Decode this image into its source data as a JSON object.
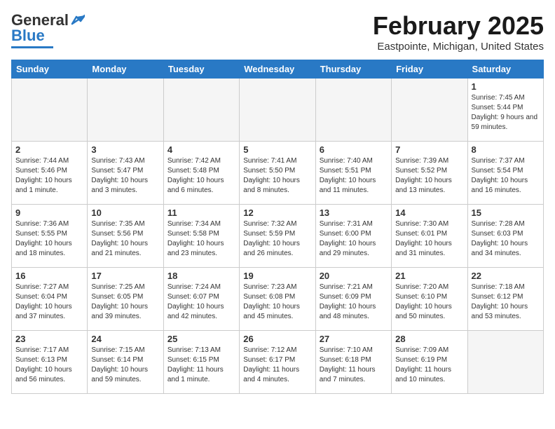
{
  "header": {
    "logo_general": "General",
    "logo_blue": "Blue",
    "title": "February 2025",
    "subtitle": "Eastpointe, Michigan, United States"
  },
  "weekdays": [
    "Sunday",
    "Monday",
    "Tuesday",
    "Wednesday",
    "Thursday",
    "Friday",
    "Saturday"
  ],
  "weeks": [
    [
      {
        "day": "",
        "info": ""
      },
      {
        "day": "",
        "info": ""
      },
      {
        "day": "",
        "info": ""
      },
      {
        "day": "",
        "info": ""
      },
      {
        "day": "",
        "info": ""
      },
      {
        "day": "",
        "info": ""
      },
      {
        "day": "1",
        "info": "Sunrise: 7:45 AM\nSunset: 5:44 PM\nDaylight: 9 hours and 59 minutes."
      }
    ],
    [
      {
        "day": "2",
        "info": "Sunrise: 7:44 AM\nSunset: 5:46 PM\nDaylight: 10 hours and 1 minute."
      },
      {
        "day": "3",
        "info": "Sunrise: 7:43 AM\nSunset: 5:47 PM\nDaylight: 10 hours and 3 minutes."
      },
      {
        "day": "4",
        "info": "Sunrise: 7:42 AM\nSunset: 5:48 PM\nDaylight: 10 hours and 6 minutes."
      },
      {
        "day": "5",
        "info": "Sunrise: 7:41 AM\nSunset: 5:50 PM\nDaylight: 10 hours and 8 minutes."
      },
      {
        "day": "6",
        "info": "Sunrise: 7:40 AM\nSunset: 5:51 PM\nDaylight: 10 hours and 11 minutes."
      },
      {
        "day": "7",
        "info": "Sunrise: 7:39 AM\nSunset: 5:52 PM\nDaylight: 10 hours and 13 minutes."
      },
      {
        "day": "8",
        "info": "Sunrise: 7:37 AM\nSunset: 5:54 PM\nDaylight: 10 hours and 16 minutes."
      }
    ],
    [
      {
        "day": "9",
        "info": "Sunrise: 7:36 AM\nSunset: 5:55 PM\nDaylight: 10 hours and 18 minutes."
      },
      {
        "day": "10",
        "info": "Sunrise: 7:35 AM\nSunset: 5:56 PM\nDaylight: 10 hours and 21 minutes."
      },
      {
        "day": "11",
        "info": "Sunrise: 7:34 AM\nSunset: 5:58 PM\nDaylight: 10 hours and 23 minutes."
      },
      {
        "day": "12",
        "info": "Sunrise: 7:32 AM\nSunset: 5:59 PM\nDaylight: 10 hours and 26 minutes."
      },
      {
        "day": "13",
        "info": "Sunrise: 7:31 AM\nSunset: 6:00 PM\nDaylight: 10 hours and 29 minutes."
      },
      {
        "day": "14",
        "info": "Sunrise: 7:30 AM\nSunset: 6:01 PM\nDaylight: 10 hours and 31 minutes."
      },
      {
        "day": "15",
        "info": "Sunrise: 7:28 AM\nSunset: 6:03 PM\nDaylight: 10 hours and 34 minutes."
      }
    ],
    [
      {
        "day": "16",
        "info": "Sunrise: 7:27 AM\nSunset: 6:04 PM\nDaylight: 10 hours and 37 minutes."
      },
      {
        "day": "17",
        "info": "Sunrise: 7:25 AM\nSunset: 6:05 PM\nDaylight: 10 hours and 39 minutes."
      },
      {
        "day": "18",
        "info": "Sunrise: 7:24 AM\nSunset: 6:07 PM\nDaylight: 10 hours and 42 minutes."
      },
      {
        "day": "19",
        "info": "Sunrise: 7:23 AM\nSunset: 6:08 PM\nDaylight: 10 hours and 45 minutes."
      },
      {
        "day": "20",
        "info": "Sunrise: 7:21 AM\nSunset: 6:09 PM\nDaylight: 10 hours and 48 minutes."
      },
      {
        "day": "21",
        "info": "Sunrise: 7:20 AM\nSunset: 6:10 PM\nDaylight: 10 hours and 50 minutes."
      },
      {
        "day": "22",
        "info": "Sunrise: 7:18 AM\nSunset: 6:12 PM\nDaylight: 10 hours and 53 minutes."
      }
    ],
    [
      {
        "day": "23",
        "info": "Sunrise: 7:17 AM\nSunset: 6:13 PM\nDaylight: 10 hours and 56 minutes."
      },
      {
        "day": "24",
        "info": "Sunrise: 7:15 AM\nSunset: 6:14 PM\nDaylight: 10 hours and 59 minutes."
      },
      {
        "day": "25",
        "info": "Sunrise: 7:13 AM\nSunset: 6:15 PM\nDaylight: 11 hours and 1 minute."
      },
      {
        "day": "26",
        "info": "Sunrise: 7:12 AM\nSunset: 6:17 PM\nDaylight: 11 hours and 4 minutes."
      },
      {
        "day": "27",
        "info": "Sunrise: 7:10 AM\nSunset: 6:18 PM\nDaylight: 11 hours and 7 minutes."
      },
      {
        "day": "28",
        "info": "Sunrise: 7:09 AM\nSunset: 6:19 PM\nDaylight: 11 hours and 10 minutes."
      },
      {
        "day": "",
        "info": ""
      }
    ]
  ]
}
